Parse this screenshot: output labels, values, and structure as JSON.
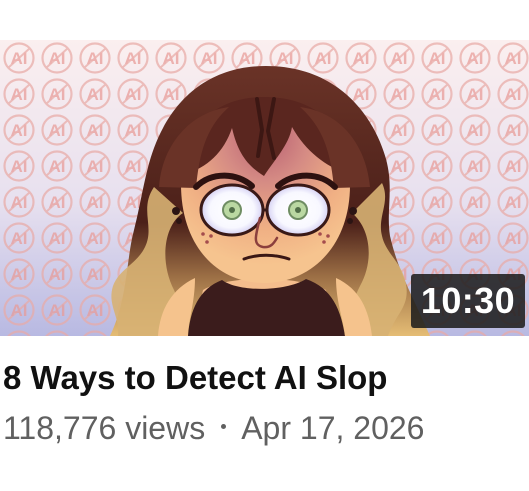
{
  "video": {
    "duration": "10:30",
    "title": "8 Ways to Detect AI Slop",
    "views": "118,776 views",
    "date": "Apr 17, 2026"
  },
  "thumbnail": {
    "pattern_mark": "AI",
    "pattern_line_color": "#e8aaa6",
    "pattern_text_color": "#e89a96",
    "gradient_top": "#fbefef",
    "gradient_bottom": "#b8b9e2"
  },
  "colors": {
    "title": "#111111",
    "meta": "#606060",
    "badge_bg": "#1b1b1b",
    "badge_text": "#ffffff"
  },
  "icons": {
    "thumbnail_character": "cartoon-portrait-icon",
    "background_mark": "no-ai-symbol-icon",
    "separator": "dot-icon"
  }
}
